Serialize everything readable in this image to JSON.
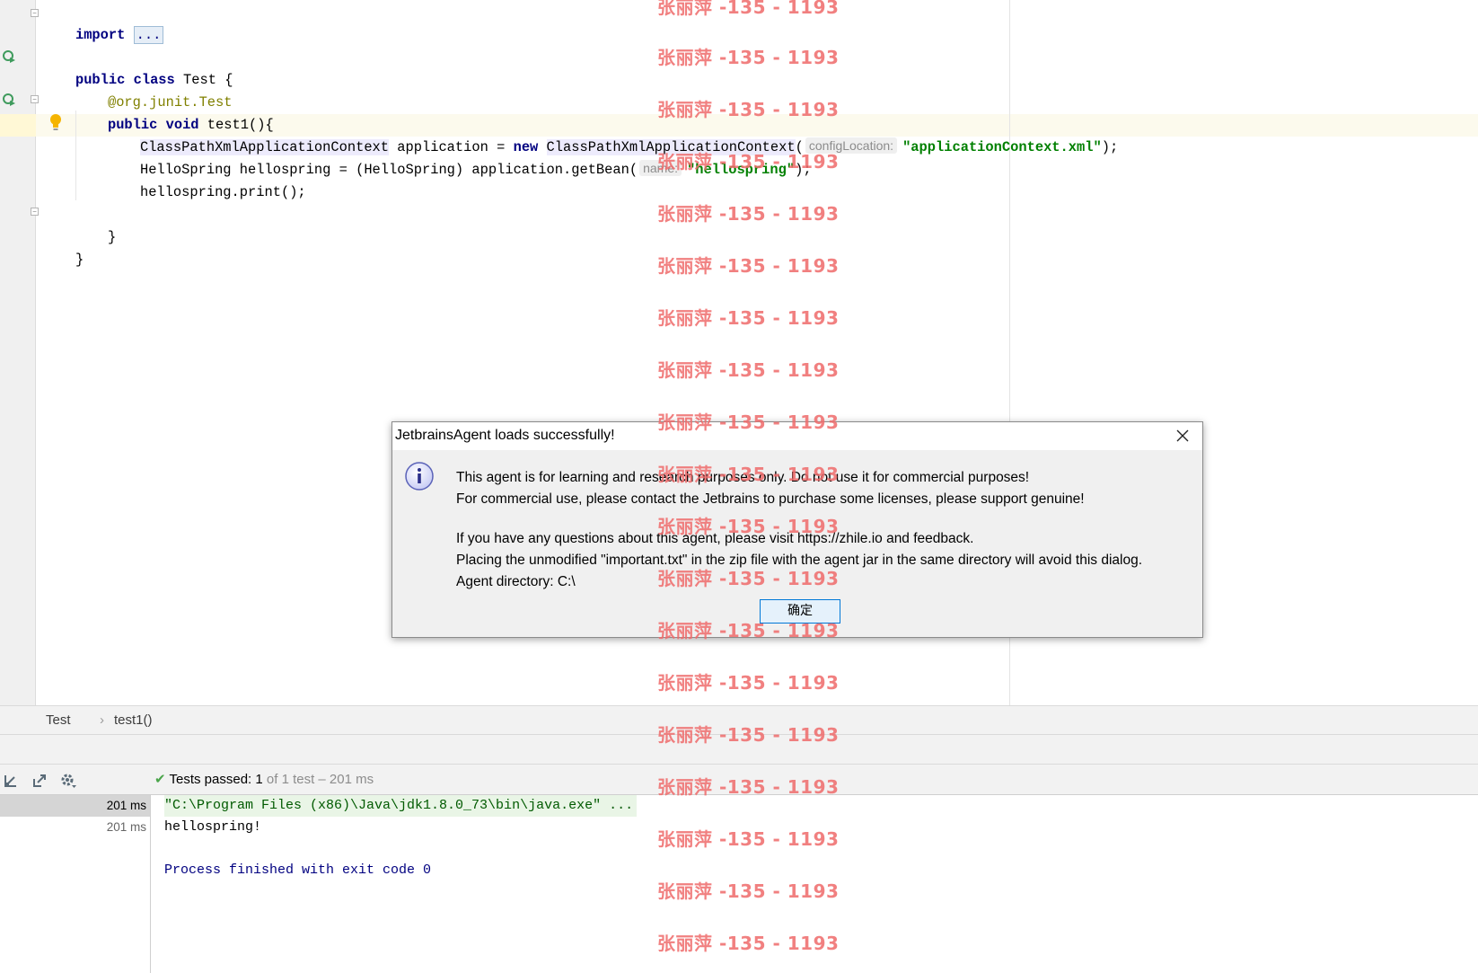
{
  "editor": {
    "lines": {
      "import_kw": "import",
      "import_fold": "...",
      "class_decl_kw": "public class",
      "class_decl_rest": " Test {",
      "annotation_prefix": "@org.junit.",
      "annotation_name": "Test",
      "method_kw": "public void",
      "method_rest": " test1(){",
      "l1_type": "ClassPathXmlApplicationContext",
      "l1_var": " application = ",
      "l1_new": "new",
      "l1_ctor": "ClassPathXmlApplicationContext",
      "l1_paren": "(",
      "l1_hint": "configLocation:",
      "l1_arg": "\"applicationContext.xml\"",
      "l1_end": ");",
      "l2_code": "HelloSpring hellospring = (HelloSpring) application.getBean(",
      "l2_hint": "name:",
      "l2_arg": "\"hellospring\"",
      "l2_end": ");",
      "l3_code": "hellospring.print();",
      "close_method": "}",
      "close_class": "}"
    },
    "icons": [
      "run-test-icon",
      "run-test-icon",
      "lightbulb-icon",
      "fold-icon"
    ]
  },
  "breadcrumb": {
    "items": [
      "Test",
      "test1()"
    ],
    "separator": "›"
  },
  "run": {
    "status_label": "Tests passed:",
    "status_count": "1",
    "status_rest": "of 1 test – 201 ms",
    "tree": [
      {
        "time": "201 ms",
        "selected": true
      },
      {
        "time": "201 ms",
        "selected": false
      }
    ],
    "console": {
      "command": "\"C:\\Program Files (x86)\\Java\\jdk1.8.0_73\\bin\\java.exe\" ...",
      "output": "hellospring!",
      "exit": "Process finished with exit code 0"
    },
    "toolbar_icons": [
      "sort-icon",
      "export-icon",
      "settings-icon"
    ]
  },
  "dialog": {
    "title": "JetbrainsAgent loads successfully!",
    "line1": "This agent is for learning and research purposes only. Do not use it for commercial purposes!",
    "line2": "For commercial use, please contact the Jetbrains to purchase some licenses, please support genuine!",
    "line3": "If you have any questions about this agent, please visit https://zhile.io and feedback.",
    "line4": "Placing the unmodified \"important.txt\" in the zip file with the agent jar in the same directory will avoid this dialog.",
    "line5": "Agent directory: C:\\",
    "ok_label": "确定",
    "icon": "info-icon"
  },
  "watermark": {
    "text": "张丽萍 -135 - 1193",
    "color": "#ef6b6b"
  },
  "colors": {
    "keyword": "#000080",
    "string": "#008000",
    "annotation": "#808000",
    "pass_green": "#4aa54a"
  }
}
